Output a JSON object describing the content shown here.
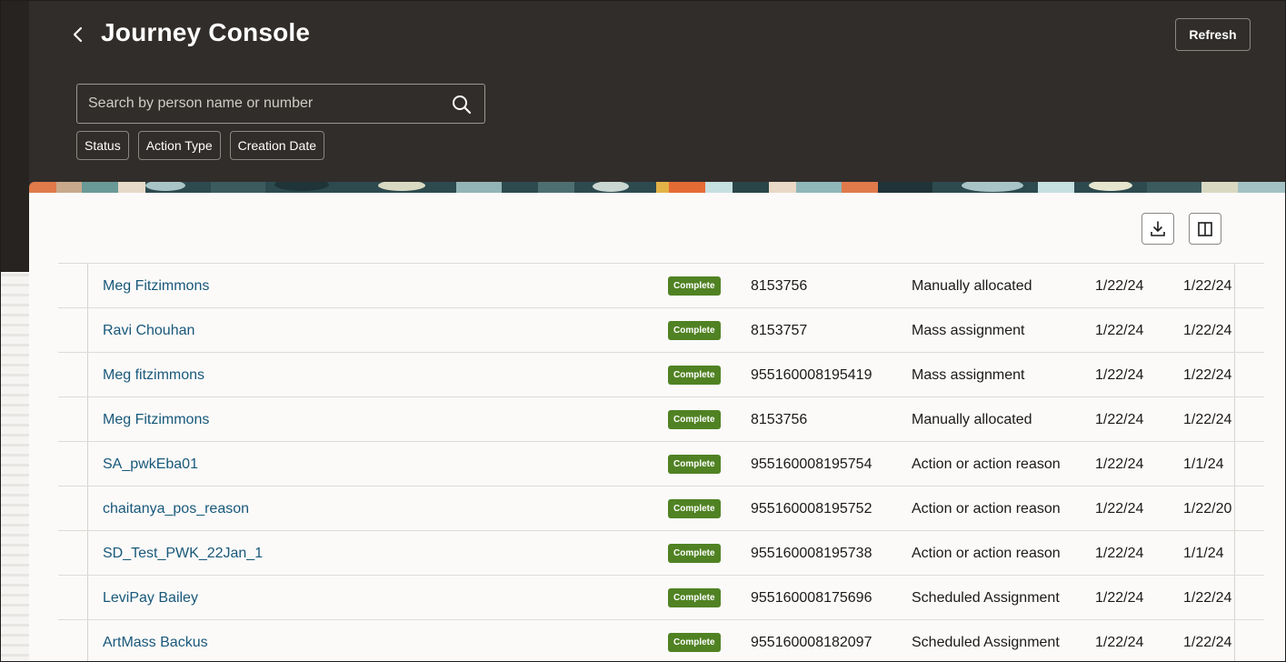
{
  "header": {
    "title": "Journey Console",
    "refresh_label": "Refresh",
    "back_icon": "chevron-left-icon"
  },
  "search": {
    "placeholder": "Search by person name or number",
    "value": "",
    "icon": "search-icon"
  },
  "filters": [
    {
      "label": "Status"
    },
    {
      "label": "Action Type"
    },
    {
      "label": "Creation Date"
    }
  ],
  "toolbar": {
    "download_icon": "download-icon",
    "columns_icon": "columns-icon"
  },
  "rows": [
    {
      "name": "Meg Fitzimmons",
      "status": "Complete",
      "number": "8153756",
      "action": "Manually allocated",
      "date1": "1/22/24",
      "date2": "1/22/24"
    },
    {
      "name": "Ravi Chouhan",
      "status": "Complete",
      "number": "8153757",
      "action": "Mass assignment",
      "date1": "1/22/24",
      "date2": "1/22/24"
    },
    {
      "name": "Meg fitzimmons",
      "status": "Complete",
      "number": "955160008195419",
      "action": "Mass assignment",
      "date1": "1/22/24",
      "date2": "1/22/24"
    },
    {
      "name": "Meg Fitzimmons",
      "status": "Complete",
      "number": "8153756",
      "action": "Manually allocated",
      "date1": "1/22/24",
      "date2": "1/22/24"
    },
    {
      "name": "SA_pwkEba01",
      "status": "Complete",
      "number": "955160008195754",
      "action": "Action or action reason",
      "date1": "1/22/24",
      "date2": "1/1/24"
    },
    {
      "name": "chaitanya_pos_reason",
      "status": "Complete",
      "number": "955160008195752",
      "action": "Action or action reason",
      "date1": "1/22/24",
      "date2": "1/22/20"
    },
    {
      "name": "SD_Test_PWK_22Jan_1",
      "status": "Complete",
      "number": "955160008195738",
      "action": "Action or action reason",
      "date1": "1/22/24",
      "date2": "1/1/24"
    },
    {
      "name": "LeviPay Bailey",
      "status": "Complete",
      "number": "955160008175696",
      "action": "Scheduled Assignment",
      "date1": "1/22/24",
      "date2": "1/22/24"
    },
    {
      "name": "ArtMass Backus",
      "status": "Complete",
      "number": "955160008182097",
      "action": "Scheduled Assignment",
      "date1": "1/22/24",
      "date2": "1/22/24"
    }
  ],
  "colors": {
    "header_bg": "#312d2a",
    "link": "#18587a",
    "badge_bg": "#508223"
  }
}
